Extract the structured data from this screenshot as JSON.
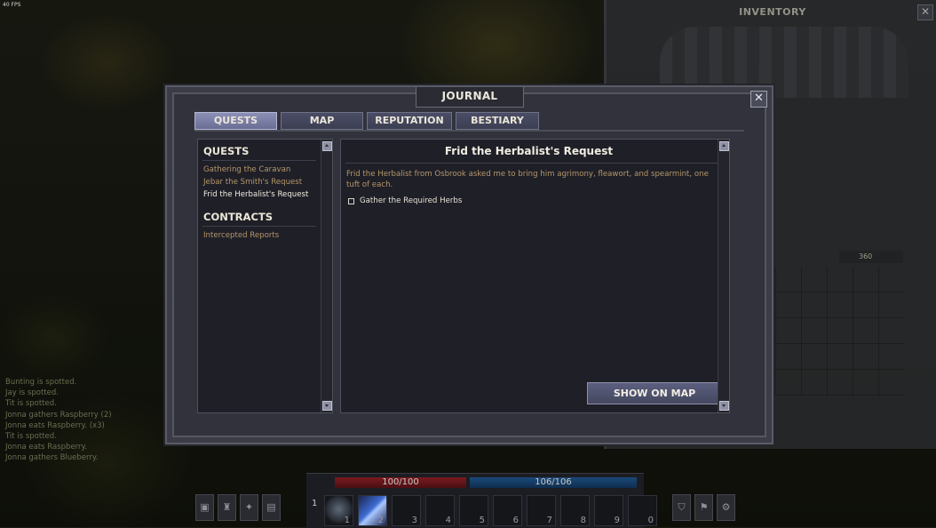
{
  "fps": "40 FPS",
  "message_log": [
    "Bunting is spotted.",
    "Jay is spotted.",
    "Tit is spotted.",
    "Jonna gathers Raspberry (2)",
    "Jonna eats Raspberry. (x3)",
    "Tit is spotted.",
    "Jonna eats Raspberry.",
    "Jonna gathers Blueberry."
  ],
  "inventory": {
    "title": "INVENTORY",
    "close_label": "✕",
    "gold": "360"
  },
  "journal": {
    "title": "JOURNAL",
    "close_label": "✕",
    "tabs": [
      {
        "label": "QUESTS",
        "active": true
      },
      {
        "label": "MAP",
        "active": false
      },
      {
        "label": "REPUTATION",
        "active": false
      },
      {
        "label": "BESTIARY",
        "active": false
      }
    ],
    "quests_heading": "QUESTS",
    "quests": [
      "Gathering the Caravan",
      "Jebar the Smith's Request",
      "Frid the Herbalist's Request"
    ],
    "selected_quest_index": 2,
    "contracts_heading": "CONTRACTS",
    "contracts": [
      "Intercepted Reports"
    ],
    "detail": {
      "title": "Frid the Herbalist's Request",
      "description": "Frid the Herbalist from Osbrook asked me to bring him agrimony, fleawort, and spearmint, one tuft of each.",
      "objectives": [
        {
          "label": "Gather the Required Herbs",
          "done": false
        }
      ],
      "show_on_map_label": "SHOW ON MAP"
    }
  },
  "hud": {
    "health": "100/100",
    "mana": "106/106",
    "hotbar_page": "1",
    "slots": [
      "1",
      "2",
      "3",
      "4",
      "5",
      "6",
      "7",
      "8",
      "9",
      "0"
    ]
  },
  "colors": {
    "panel": "#31323b",
    "quest_link": "#b4976a",
    "selected_text": "#efece2",
    "tab_active": "#8d90b6"
  }
}
